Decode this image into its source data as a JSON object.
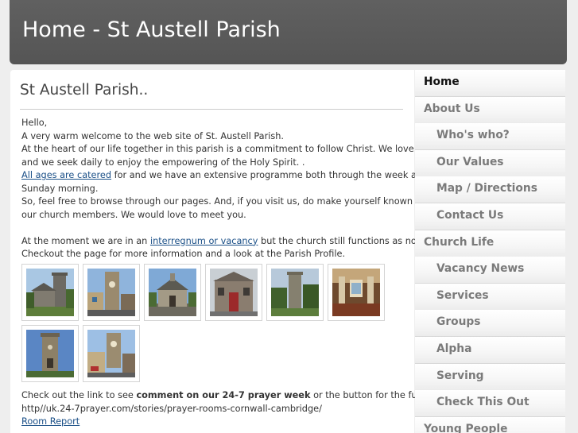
{
  "header": {
    "title": "Home - St Austell Parish"
  },
  "main": {
    "title": "St Austell Parish..",
    "greeting": "Hello,",
    "line1": "A very warm welcome to the web site of St. Austell Parish.",
    "line2": "At the heart of our life together in this parish is a commitment to follow Christ. We love God's Word,",
    "line3": "and we seek daily to enjoy the empowering of the Holy Spirit. .",
    "line4_link": "All ages are catered",
    "line4_rest": " for and we have an extensive programme both through the week and on a",
    "line5": "Sunday morning.",
    "line6": "So, feel free to browse through our pages. And, if you visit us, do make yourself known to any of",
    "line7": "our church members. We would love to meet you.",
    "line8_pre": "At the moment we are in an ",
    "line8_link": "interregnum or vacancy",
    "line8_rest": " but the church still functions as normal.",
    "line9": "Checkout the page for more information and a look at the Parish Profile.",
    "footer_pre": "Check out the link to see ",
    "footer_bold": "comment on our 24-7 prayer week",
    "footer_rest": " or the button for the full report.",
    "footer_url": "http//uk.24-7prayer.com/stories/prayer-rooms-cornwall-cambridge/",
    "room_report_link": "Room Report"
  },
  "gallery": {
    "photos": [
      "church-photo",
      "clock-tower-photo",
      "chapel-photo",
      "stone-building-photo",
      "tower-trees-photo",
      "church-interior-photo",
      "tower-photo",
      "clock-tower-street-photo"
    ]
  },
  "nav": {
    "items": [
      {
        "label": "Home",
        "level": "top",
        "active": true
      },
      {
        "label": "About Us",
        "level": "top",
        "active": false
      },
      {
        "label": "Who's who?",
        "level": "sub",
        "active": false
      },
      {
        "label": "Our Values",
        "level": "sub",
        "active": false
      },
      {
        "label": "Map / Directions",
        "level": "sub",
        "active": false
      },
      {
        "label": "Contact Us",
        "level": "sub",
        "active": false
      },
      {
        "label": "Church Life",
        "level": "top",
        "active": false
      },
      {
        "label": "Vacancy News",
        "level": "sub",
        "active": false
      },
      {
        "label": "Services",
        "level": "sub",
        "active": false
      },
      {
        "label": "Groups",
        "level": "sub",
        "active": false
      },
      {
        "label": "Alpha",
        "level": "sub",
        "active": false
      },
      {
        "label": "Serving",
        "level": "sub",
        "active": false
      },
      {
        "label": "Check This Out",
        "level": "sub",
        "active": false
      },
      {
        "label": "Young People",
        "level": "top",
        "active": false
      }
    ]
  }
}
